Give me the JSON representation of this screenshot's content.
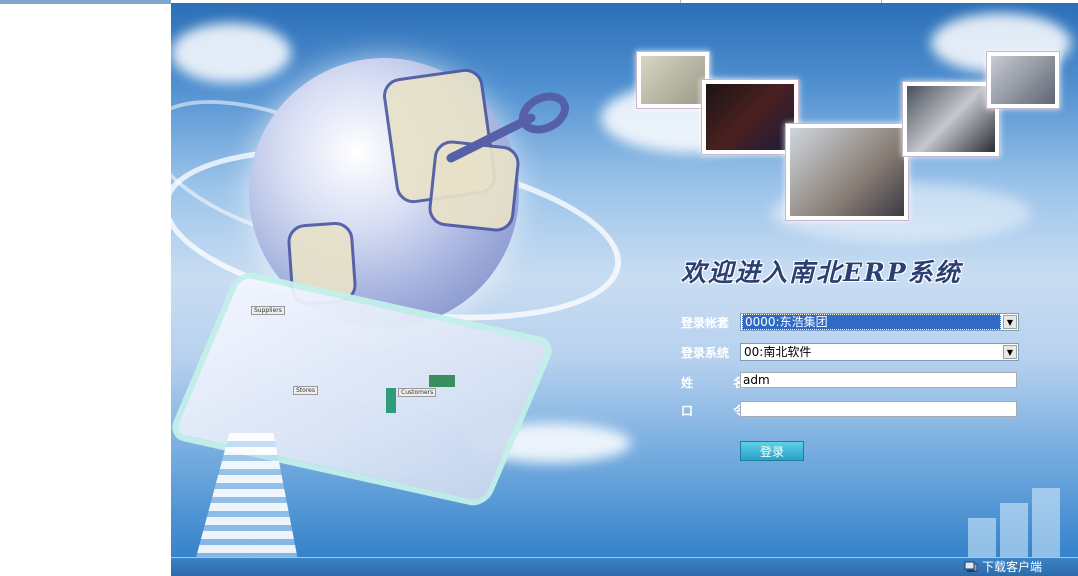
{
  "welcome_title": "欢迎进入南北ERP系统",
  "form": {
    "account_label": "登录帐套",
    "account_value": "0000:东浩集团",
    "system_label": "登录系统",
    "system_value": "00:南北软件",
    "name_label": "姓 名",
    "name_value": "adm",
    "password_label": "口 令",
    "password_value": "",
    "login_button": "登录"
  },
  "footer": {
    "download_label": "下载客户端"
  },
  "diagram_labels": [
    "Suppliers",
    "Stores",
    "Customers"
  ],
  "colors": {
    "banner_sky": "#4f8fd0",
    "selected_option": "#316ac5",
    "login_button": "#2aa2c6",
    "welcome_text": "#2b3f72"
  },
  "icons": {
    "dropdown": "chevron-down-icon",
    "download": "computer-icon"
  }
}
